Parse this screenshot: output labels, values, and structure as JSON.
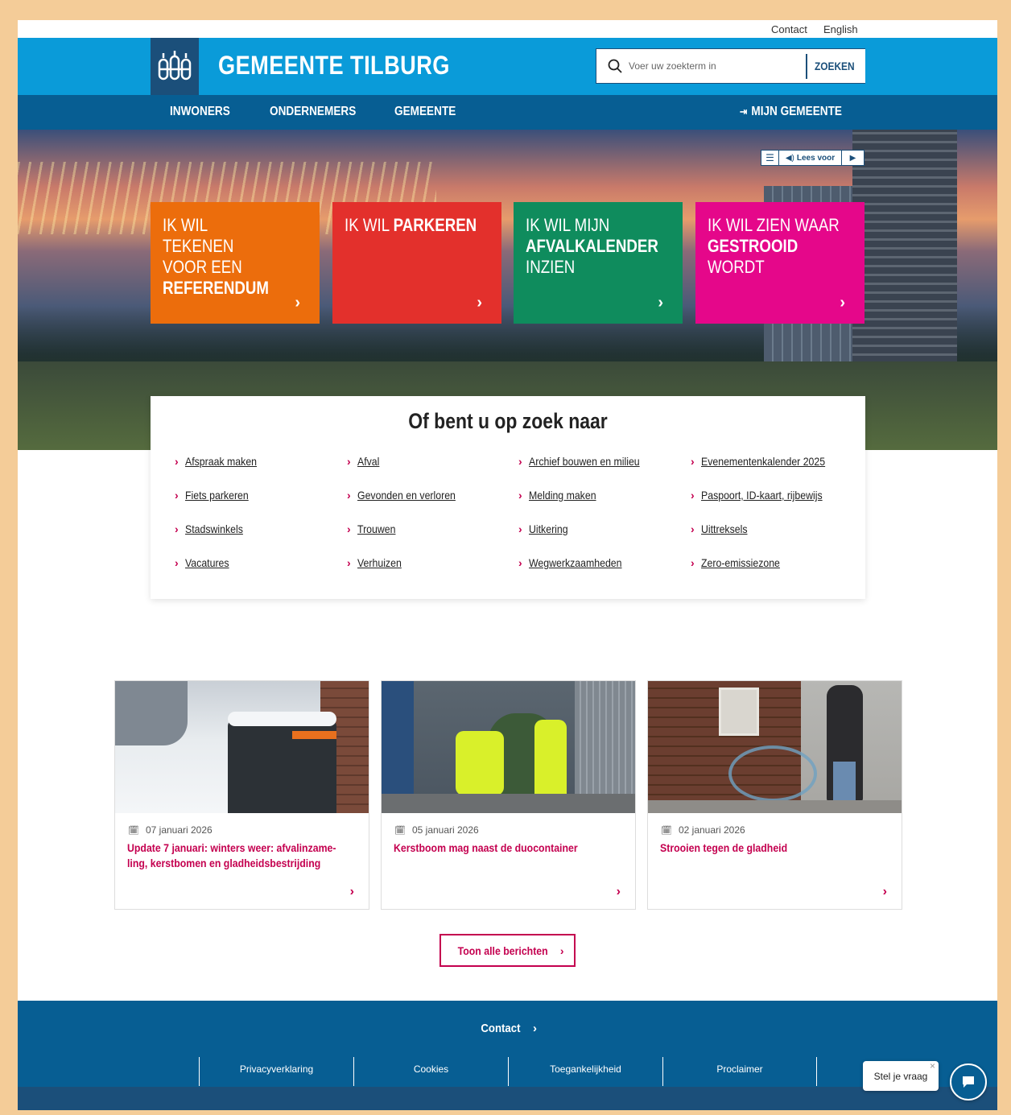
{
  "utility": {
    "contact": "Contact",
    "english": "English"
  },
  "header": {
    "brand": "GEMEENTE TILBURG",
    "search_placeholder": "Voer uw zoekterm in",
    "search_button": "ZOEKEN"
  },
  "nav": {
    "items": [
      "INWONERS",
      "ONDERNEMERS",
      "GEMEENTE"
    ],
    "mijn": "MIJN GEMEENTE"
  },
  "readbar": {
    "label": "Lees voor"
  },
  "tiles": [
    {
      "light": "IK WIL TEKENEN VOOR EEN",
      "bold": "REFERENDUM",
      "color": "#ec6d0c"
    },
    {
      "light": "IK WIL",
      "bold": "PARKEREN",
      "color": "#e3302c"
    },
    {
      "light": "IK WIL MIJN",
      "bold": "AFVALKALENDER",
      "light2": "INZIEN",
      "color": "#0f8c5d"
    },
    {
      "light": "IK WIL ZIEN WAAR",
      "bold": "GESTROOID",
      "light2": "WORDT",
      "color": "#e5078a"
    }
  ],
  "zoek": {
    "title": "Of bent u op zoek naar",
    "links": [
      [
        "Afspraak maken",
        "Afval",
        "Archief bouwen en milieu",
        "Evenementenkalender 2025"
      ],
      [
        "Fiets parkeren",
        "Gevonden en verloren",
        "Melding maken",
        "Paspoort, ID-kaart, rijbewijs"
      ],
      [
        "Stadswinkels",
        "Trouwen",
        "Uitkering",
        "Uittreksels"
      ],
      [
        "Vacatures",
        "Verhuizen",
        "Wegwerkzaamheden",
        "Zero-emissiezone"
      ]
    ]
  },
  "news": [
    {
      "date": "07 januari 2026",
      "title": "Update 7 januari: winters weer: afvalinzame-ling, kerstbomen en gladheidsbestrijding"
    },
    {
      "date": "05 januari 2026",
      "title": "Kerstboom mag naast de duocontainer"
    },
    {
      "date": "02 januari 2026",
      "title": "Strooien tegen de gladheid"
    }
  ],
  "toon_alle": "Toon alle berichten",
  "footer": {
    "contact": "Contact",
    "links": [
      "Privacyverklaring",
      "Cookies",
      "Toegankelijkheid",
      "Proclaimer"
    ]
  },
  "chat": {
    "label": "Stel je vraag"
  }
}
